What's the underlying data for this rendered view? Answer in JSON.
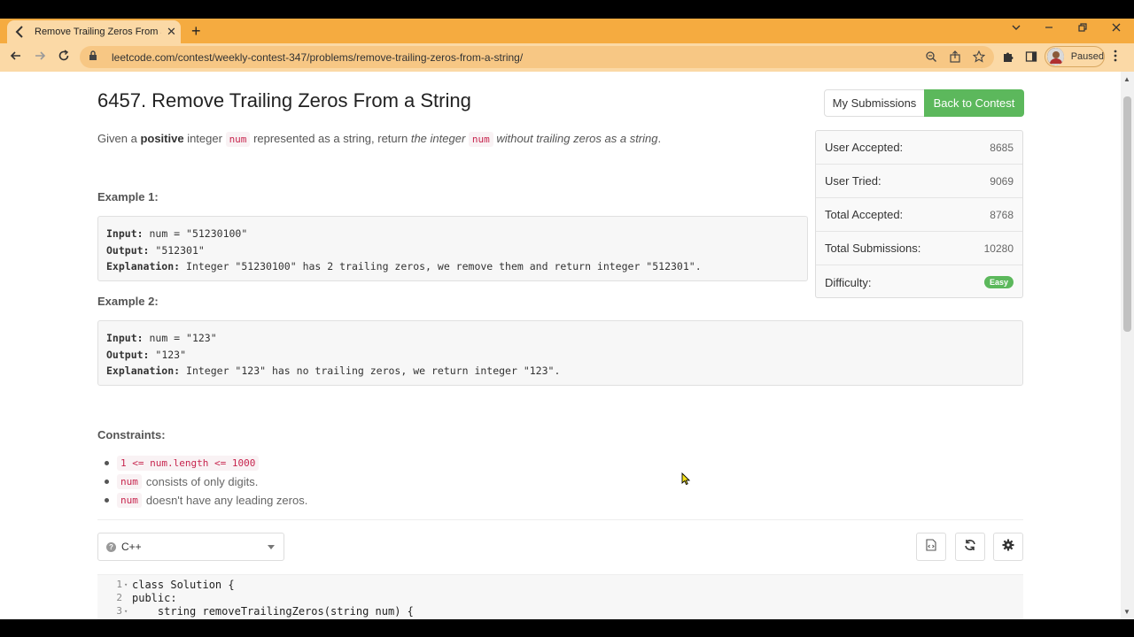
{
  "browser": {
    "tab_title": "Remove Trailing Zeros From a String - LeetCode Contest",
    "url": "leetcode.com/contest/weekly-contest-347/problems/remove-trailing-zeros-from-a-string/",
    "profile_status": "Paused",
    "theme_color": "#f5ab40"
  },
  "problem": {
    "title": "6457. Remove Trailing Zeros From a String",
    "my_submissions_label": "My Submissions",
    "back_to_contest_label": "Back to Contest",
    "desc_given": "Given a",
    "desc_positive": "positive",
    "desc_integer": "integer",
    "desc_num": "num",
    "desc_represented": "represented as a string, return",
    "desc_the_integer": "the integer",
    "desc_without": "without trailing zeros as a string",
    "desc_period": "."
  },
  "stats": [
    {
      "label": "User Accepted:",
      "value": "8685"
    },
    {
      "label": "User Tried:",
      "value": "9069"
    },
    {
      "label": "Total Accepted:",
      "value": "8768"
    },
    {
      "label": "Total Submissions:",
      "value": "10280"
    },
    {
      "label": "Difficulty:",
      "value": "Easy"
    }
  ],
  "examples": [
    {
      "label": "Example 1:",
      "input_key": "Input:",
      "input_val": "num = \"51230100\"",
      "output_key": "Output:",
      "output_val": "\"512301\"",
      "expl_key": "Explanation:",
      "expl_val": "Integer \"51230100\" has 2 trailing zeros, we remove them and return integer \"512301\"."
    },
    {
      "label": "Example 2:",
      "input_key": "Input:",
      "input_val": "num = \"123\"",
      "output_key": "Output:",
      "output_val": "\"123\"",
      "expl_key": "Explanation:",
      "expl_val": "Integer \"123\" has no trailing zeros, we return integer \"123\"."
    }
  ],
  "constraints": {
    "heading": "Constraints:",
    "c1_code": "1 <= num.length <= 1000",
    "c2_code": "num",
    "c2_text": "consists of only digits.",
    "c3_code": "num",
    "c3_text": "doesn't have any leading zeros."
  },
  "editor": {
    "language": "C++",
    "lines": [
      {
        "num": "1",
        "fold": "▾",
        "text": "class Solution {"
      },
      {
        "num": "2",
        "fold": "",
        "text": "public:"
      },
      {
        "num": "3",
        "fold": "▾",
        "text": "    string removeTrailingZeros(string num) {"
      }
    ]
  }
}
